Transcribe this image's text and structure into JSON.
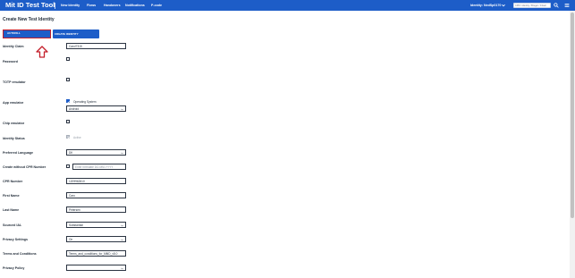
{
  "header": {
    "brand": "Mit ID Test Tool",
    "nav": [
      "New Identity",
      "Flows",
      "Handovers",
      "Notifications",
      "P-code"
    ],
    "identity_chip": "Identity: NedSp0170",
    "search_text": "CPR / Identity / Bruger / Frisør",
    "colors": {
      "header_bg": "#1d5dc8",
      "accent_red": "#c41e2a"
    }
  },
  "page": {
    "title": "Create New Test Identity",
    "autofill_label": "AUTOFILL",
    "create_label": "CREATE IDENTITY"
  },
  "form": {
    "identity_claim": {
      "label": "Identity Claim",
      "value": "Carol7315"
    },
    "password": {
      "label": "Password",
      "checked": false
    },
    "totp": {
      "label": "TOTP emulator",
      "checked": false
    },
    "app_emulator": {
      "label": "App emulator",
      "os_label": "Operating System",
      "checked": true,
      "select": "Android"
    },
    "chip_emulator": {
      "label": "Chip emulator",
      "checked": false
    },
    "identity_status": {
      "label": "Identity Status",
      "checkbox_label": "Active"
    },
    "preferred_language": {
      "label": "Preferred Language",
      "select": "DK"
    },
    "without_cpr": {
      "label": "Create without CPR Number",
      "placeholder": "Enter birthdate DD-MM-YYYY"
    },
    "cpr_number": {
      "label": "CPR Number",
      "value": "1209962610"
    },
    "first_name": {
      "label": "First Name",
      "value": "Caro"
    },
    "last_name": {
      "label": "Last Name",
      "value": "Petersen"
    },
    "sourced_ial": {
      "label": "Sourced IAL",
      "select": "Substantial"
    },
    "privacy_settings": {
      "label": "Privacy Settings",
      "select": "On"
    },
    "terms": {
      "label": "Terms and Conditions",
      "value": "Terms_and_conditions_for_MitID_v8.0"
    },
    "privacy_policy": {
      "label": "Privacy Policy",
      "select": ""
    }
  }
}
